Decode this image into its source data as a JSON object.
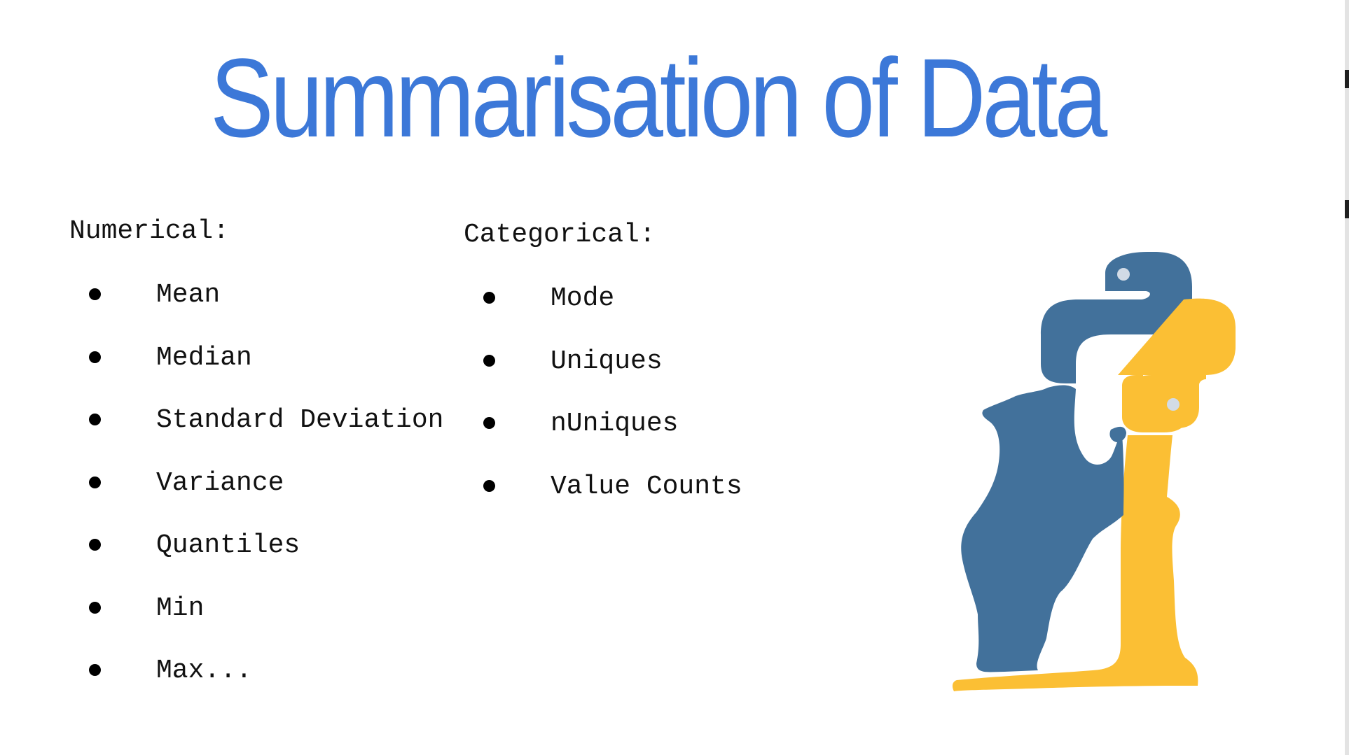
{
  "slide": {
    "title": "Summarisation of Data",
    "title_color": "#3c78d8"
  },
  "numerical": {
    "heading": "Numerical:",
    "items": [
      "Mean",
      "Median",
      "Standard Deviation",
      "Variance",
      "Quantiles",
      "Min",
      "Max..."
    ]
  },
  "categorical": {
    "heading": "Categorical:",
    "items": [
      "Mode",
      "Uniques",
      "nUniques",
      "Value Counts"
    ]
  },
  "logo": {
    "icon": "pandas-python-bear-logo-icon",
    "colors": {
      "blue": "#42719b",
      "yellow": "#fbbf34",
      "light": "#d2dbe6"
    }
  }
}
